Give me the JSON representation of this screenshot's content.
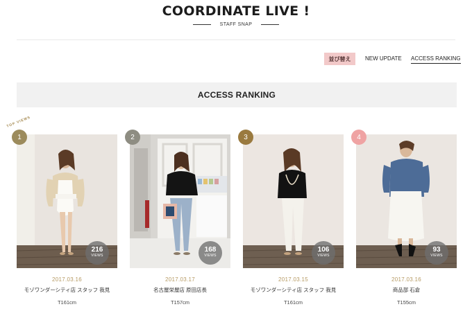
{
  "header": {
    "title": "COORDINATE LIVE !",
    "subtitle": "STAFF SNAP"
  },
  "sort": {
    "badge": "並び替え",
    "new_update": "NEW UPDATE",
    "access_ranking": "ACCESS RANKING"
  },
  "section_title": "ACCESS RANKING",
  "top_views_label": "TOP VIEWS",
  "views_label": "VIEWS",
  "colors": {
    "rank_1": "#9c8b5c",
    "rank_2": "#8e8d82",
    "rank_3": "#9a7a3f",
    "rank_4": "#efa3a3",
    "date": "#b69a63",
    "badge_bg": "#f2c9c9",
    "section_bar": "#f1f1f1"
  },
  "cards": [
    {
      "rank": "1",
      "views": "216",
      "date": "2017.03.16",
      "shop": "モゾワンダーシティ店 スタッフ 我見",
      "height": "T161cm"
    },
    {
      "rank": "2",
      "views": "168",
      "date": "2017.03.17",
      "shop": "名古屋栄屋店 原田店長",
      "height": "T157cm"
    },
    {
      "rank": "3",
      "views": "106",
      "date": "2017.03.15",
      "shop": "モゾワンダーシティ店 スタッフ 我見",
      "height": "T161cm"
    },
    {
      "rank": "4",
      "views": "93",
      "date": "2017.03.16",
      "shop": "商品部 石倉",
      "height": "T155cm"
    }
  ]
}
